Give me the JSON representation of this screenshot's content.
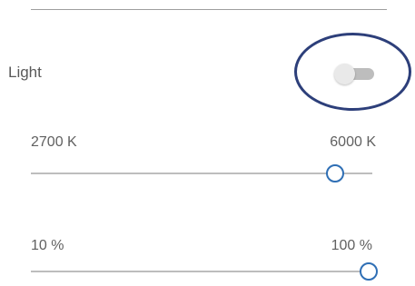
{
  "light": {
    "label": "Light",
    "toggle_on": false
  },
  "temperature": {
    "min_label": "2700 K",
    "max_label": "6000 K",
    "value_fraction": 0.89
  },
  "brightness": {
    "min_label": "10 %",
    "max_label": "100 %",
    "value_fraction": 0.99
  },
  "colors": {
    "accent": "#2f6fb5",
    "highlight": "#2d3f7a",
    "track": "#bdbdbd",
    "text": "#616161"
  }
}
